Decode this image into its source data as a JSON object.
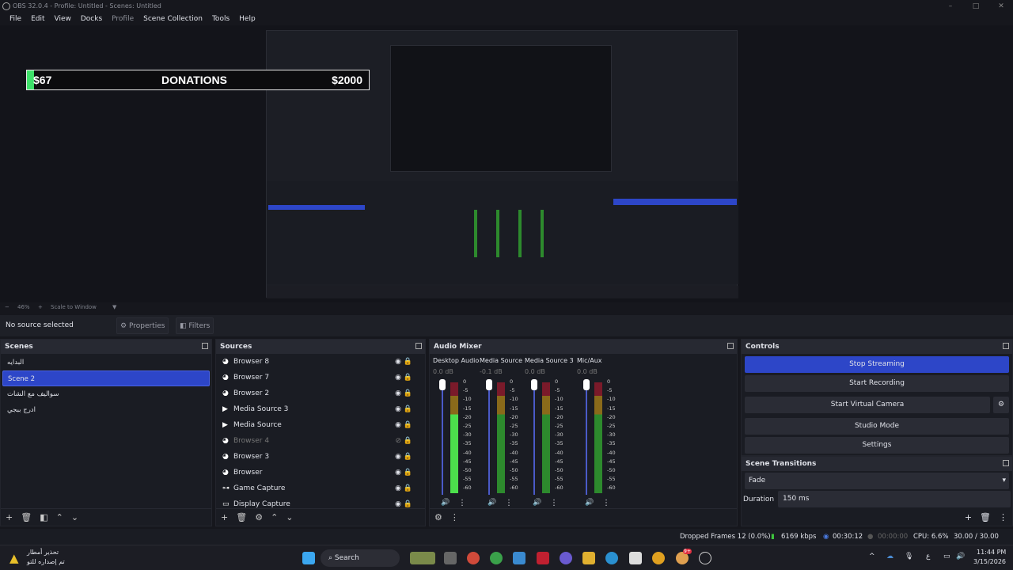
{
  "window": {
    "title": "OBS 32.0.4 - Profile: Untitled - Scenes: Untitled"
  },
  "menu": [
    {
      "label": "File"
    },
    {
      "label": "Edit"
    },
    {
      "label": "View"
    },
    {
      "label": "Docks"
    },
    {
      "label": "Profile",
      "disabled": true
    },
    {
      "label": "Scene Collection"
    },
    {
      "label": "Tools"
    },
    {
      "label": "Help"
    }
  ],
  "preview": {
    "donations": {
      "current": "$67",
      "title": "DONATIONS",
      "goal": "$2000",
      "fill_percent": 3.35,
      "accent": "#3ee06a"
    }
  },
  "zoom": {
    "level": "46%",
    "mode": "Scale to Window"
  },
  "source_toolbar": {
    "status": "No source selected",
    "properties": "Properties",
    "filters": "Filters"
  },
  "scenes": {
    "title": "Scenes",
    "items": [
      {
        "name": "البدايه"
      },
      {
        "name": "Scene 2",
        "selected": true
      },
      {
        "name": "سواليف مع الشات"
      },
      {
        "name": "ادرج ببجي"
      }
    ]
  },
  "sources": {
    "title": "Sources",
    "items": [
      {
        "name": "Browser 8",
        "icon": "globe-icon",
        "visible": true
      },
      {
        "name": "Browser 7",
        "icon": "globe-icon",
        "visible": true
      },
      {
        "name": "Browser 2",
        "icon": "globe-icon",
        "visible": true
      },
      {
        "name": "Media Source 3",
        "icon": "play-icon",
        "visible": true
      },
      {
        "name": "Media Source",
        "icon": "play-icon",
        "visible": true
      },
      {
        "name": "Browser 4",
        "icon": "globe-icon",
        "visible": false
      },
      {
        "name": "Browser 3",
        "icon": "globe-icon",
        "visible": true
      },
      {
        "name": "Browser",
        "icon": "globe-icon",
        "visible": true
      },
      {
        "name": "Game Capture",
        "icon": "gamepad-icon",
        "visible": true
      },
      {
        "name": "Display Capture",
        "icon": "monitor-icon",
        "visible": true
      }
    ]
  },
  "mixer": {
    "title": "Audio Mixer",
    "scale": [
      "0",
      "-5",
      "-10",
      "-15",
      "-20",
      "-25",
      "-30",
      "-35",
      "-40",
      "-45",
      "-50",
      "-55",
      "-60"
    ],
    "channels": [
      {
        "name": "Desktop Audio",
        "db": "0.0 dB",
        "active": true
      },
      {
        "name": "Media Source",
        "db": "-0.1 dB"
      },
      {
        "name": "Media Source 3",
        "db": "0.0 dB"
      },
      {
        "name": "Mic/Aux",
        "db": "0.0 dB"
      }
    ]
  },
  "controls": {
    "title": "Controls",
    "stop_streaming": "Stop Streaming",
    "start_recording": "Start Recording",
    "start_virtual_camera": "Start Virtual Camera",
    "studio_mode": "Studio Mode",
    "settings": "Settings",
    "accent": "#2d46c8"
  },
  "transitions": {
    "title": "Scene Transitions",
    "selected": "Fade",
    "duration_label": "Duration",
    "duration": "150 ms"
  },
  "status": {
    "dropped": "Dropped Frames 12 (0.0%)",
    "bitrate": "6169 kbps",
    "stream_time": "00:30:12",
    "rec_time": "00:00:00",
    "cpu": "CPU: 6.6%",
    "fps": "30.00 / 30.00 FPS"
  },
  "taskbar": {
    "weather_title": "تحذير أمطار",
    "weather_sub": "تم إصداره للتو",
    "search": "Search",
    "time": "11:44 PM",
    "date": "3/15/2026",
    "badge": "9+"
  }
}
